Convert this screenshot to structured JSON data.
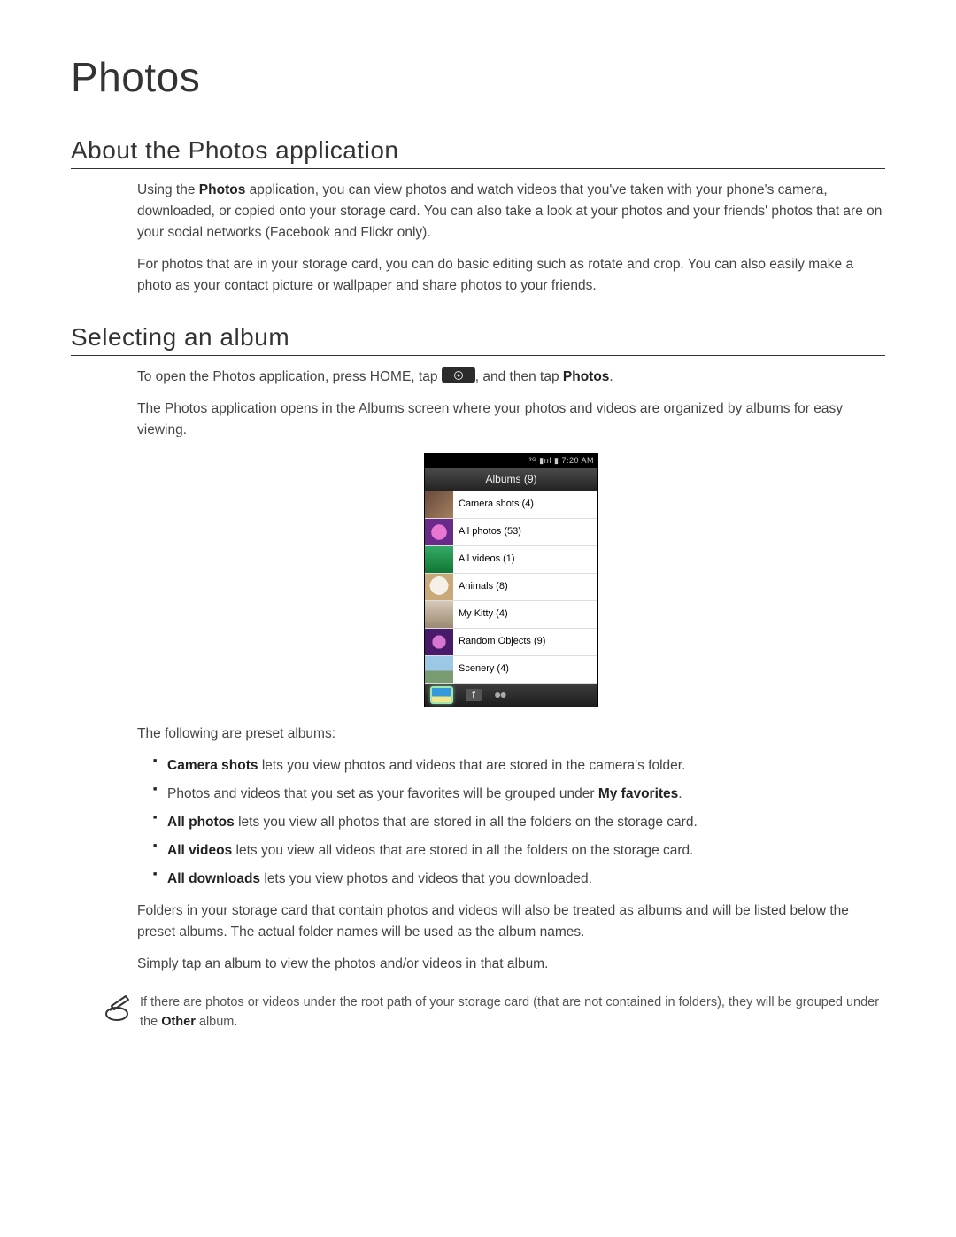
{
  "title": "Photos",
  "section1": {
    "heading": "About the Photos application",
    "p1_a": "Using the ",
    "p1_b": "Photos",
    "p1_c": " application, you can view photos and watch videos that you've taken with your phone's camera, downloaded, or copied onto your storage card. You can also take a look at your photos and your friends' photos that are on your social networks (Facebook and Flickr only).",
    "p2": "For photos that are in your storage card, you can do basic editing such as rotate and crop. You can also easily make a photo as your contact picture or wallpaper and share photos to your friends."
  },
  "section2": {
    "heading": "Selecting an album",
    "p1_a": "To open the Photos application, press HOME, tap ",
    "p1_b": ", and then tap ",
    "p1_c": "Photos",
    "p1_d": ".",
    "p2": "The Photos application opens in the Albums screen where your photos and videos are organized by albums for easy viewing.",
    "p3": "The following are preset albums:",
    "bullets": [
      {
        "b": "Camera shots",
        "t": " lets you view photos and videos that are stored in the camera's folder."
      },
      {
        "pre": "Photos and videos that you set as your favorites will be grouped under ",
        "b": "My favorites",
        "t": "."
      },
      {
        "b": "All photos",
        "t": " lets you view all photos that are stored in all the folders on the storage card."
      },
      {
        "b": "All videos",
        "t": " lets you view all videos that are stored in all the folders on the storage card."
      },
      {
        "b": "All downloads",
        "t": " lets you view photos and videos that you downloaded."
      }
    ],
    "p4": "Folders in your storage card that contain photos and videos will also be treated as albums and will be listed below the preset albums. The actual folder names will be used as the album names.",
    "p5": "Simply tap an album to view the photos and/or videos in that album.",
    "note_a": "If there are photos or videos under the root path of your storage card (that are not contained in folders), they will be grouped under the ",
    "note_b": "Other",
    "note_c": " album."
  },
  "phone": {
    "status": "³ᴳ ▮ııl ▮ 7:20 AM",
    "title": "Albums (9)",
    "albums": [
      "Camera shots  (4)",
      "All photos  (53)",
      "All videos  (1)",
      "Animals  (8)",
      "My Kitty  (4)",
      "Random Objects  (9)",
      "Scenery  (4)"
    ],
    "bb_f": "f",
    "bb_dots": "●●"
  }
}
